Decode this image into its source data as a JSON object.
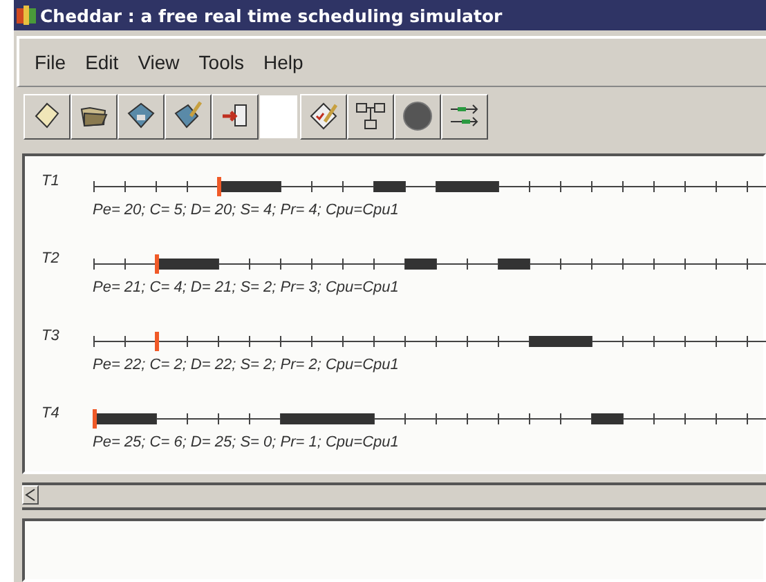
{
  "window": {
    "title": "Cheddar : a free real time scheduling simulator"
  },
  "menu": [
    "File",
    "Edit",
    "View",
    "Tools",
    "Help"
  ],
  "tasks": [
    {
      "name": "T1",
      "params": "Pe= 20; C= 5; D= 20; S= 4; Pr= 4; Cpu=Cpu1"
    },
    {
      "name": "T2",
      "params": "Pe= 21; C= 4; D= 21; S= 2; Pr= 3; Cpu=Cpu1"
    },
    {
      "name": "T3",
      "params": "Pe= 22; C= 2; D= 22; S= 2; Pr= 2; Cpu=Cpu1"
    },
    {
      "name": "T4",
      "params": "Pe= 25; C= 6; D= 25; S= 0; Pr= 1; Cpu=Cpu1"
    }
  ]
}
